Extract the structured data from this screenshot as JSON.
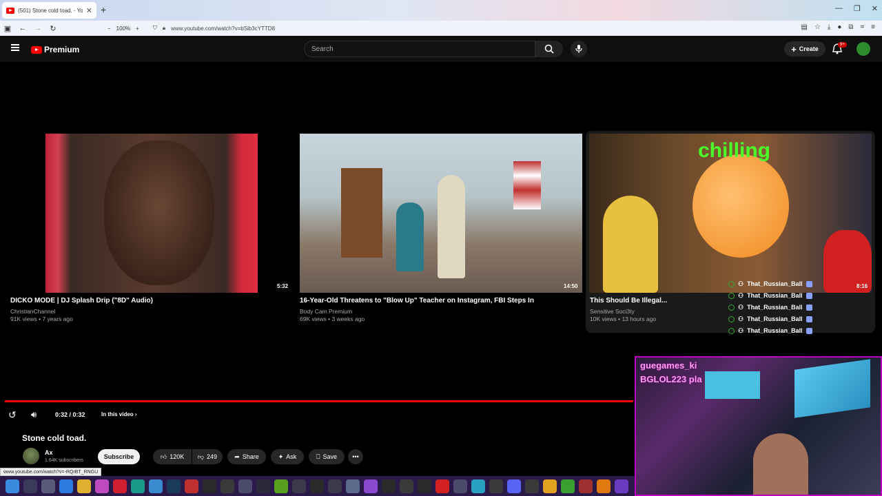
{
  "browser": {
    "tab_title": "(501) Stone cold toad. - Yo",
    "new_tab": "+",
    "zoom": "100%",
    "url": "www.youtube.com/watch?v=bSib3cYTTD8",
    "status_url": "www.youtube.com/watch?v=-RQrBT_RNGU"
  },
  "header": {
    "logo_text": "Premium",
    "search_placeholder": "Search",
    "create_label": "Create",
    "notif_badge": "9+"
  },
  "end_cards": [
    {
      "title": "DICKO MODE | DJ Splash Drip (\"8D\" Audio)",
      "channel": "ChristianChannel",
      "meta": "91K views • 7 years ago",
      "duration": "5:32"
    },
    {
      "title": "16-Year-Old Threatens to \"Blow Up\" Teacher on Instagram, FBI Steps In",
      "channel": "Body Cam Premium",
      "meta": "69K views • 3 weeks ago",
      "duration": "14:50"
    },
    {
      "title": "This Should Be Illegal...",
      "channel": "Sensitive Soci3ty",
      "meta": "10K views • 13 hours ago",
      "duration": "8:16",
      "thumb_text": "chilling"
    }
  ],
  "player": {
    "time": "0:32 / 0:32",
    "in_this_video": "In this video",
    "progress": 1.0
  },
  "video": {
    "title": "Stone cold toad.",
    "channel": "Ax",
    "subscribers": "1.64K subscribers",
    "subscribe": "Subscribe",
    "likes": "120K",
    "dislikes": "249",
    "share": "Share",
    "ask": "Ask",
    "save": "Save"
  },
  "overlay": {
    "chat_user": "That_Russian_Ball",
    "chat_lines": [
      "That_Russian_Ball",
      "That_Russian_Ball",
      "That_Russian_Ball",
      "That_Russian_Ball",
      "That_Russian_Ball"
    ],
    "cam_text_1": "guegames_ki",
    "cam_text_2": "BGLOL223 pla"
  }
}
